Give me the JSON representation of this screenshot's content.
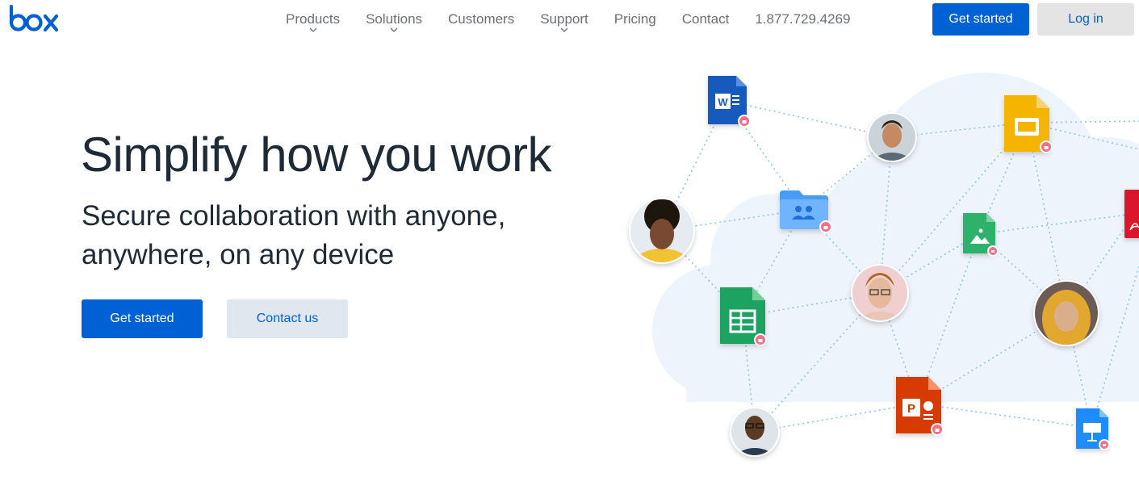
{
  "header": {
    "logo_text": "box",
    "nav": [
      {
        "label": "Products",
        "has_dropdown": true
      },
      {
        "label": "Solutions",
        "has_dropdown": true
      },
      {
        "label": "Customers",
        "has_dropdown": false
      },
      {
        "label": "Support",
        "has_dropdown": true
      },
      {
        "label": "Pricing",
        "has_dropdown": false
      },
      {
        "label": "Contact",
        "has_dropdown": false
      }
    ],
    "phone": "1.877.729.4269",
    "get_started_label": "Get started",
    "login_label": "Log in"
  },
  "hero": {
    "title": "Simplify how you work",
    "subtitle": "Secure collaboration with anyone, anywhere, on any device",
    "cta_label": "Get started",
    "contact_label": "Contact us"
  },
  "illustration": {
    "icons": [
      "word-file-icon",
      "google-slides-file-icon",
      "pdf-file-icon",
      "shared-folder-icon",
      "image-file-icon",
      "google-sheets-file-icon",
      "powerpoint-file-icon",
      "keynote-file-icon",
      "lock-badge-icon"
    ],
    "avatars": [
      "person-avatar",
      "person-avatar",
      "person-avatar",
      "person-avatar",
      "person-avatar"
    ]
  },
  "colors": {
    "brand_blue": "#0061d5",
    "text_dark": "#1e2a35",
    "nav_gray": "#6b6f73",
    "login_bg": "#e4e4e4",
    "contact_bg": "#e1e7ef",
    "cloud": "#eef4fb",
    "lock_badge": "#f36f87"
  }
}
